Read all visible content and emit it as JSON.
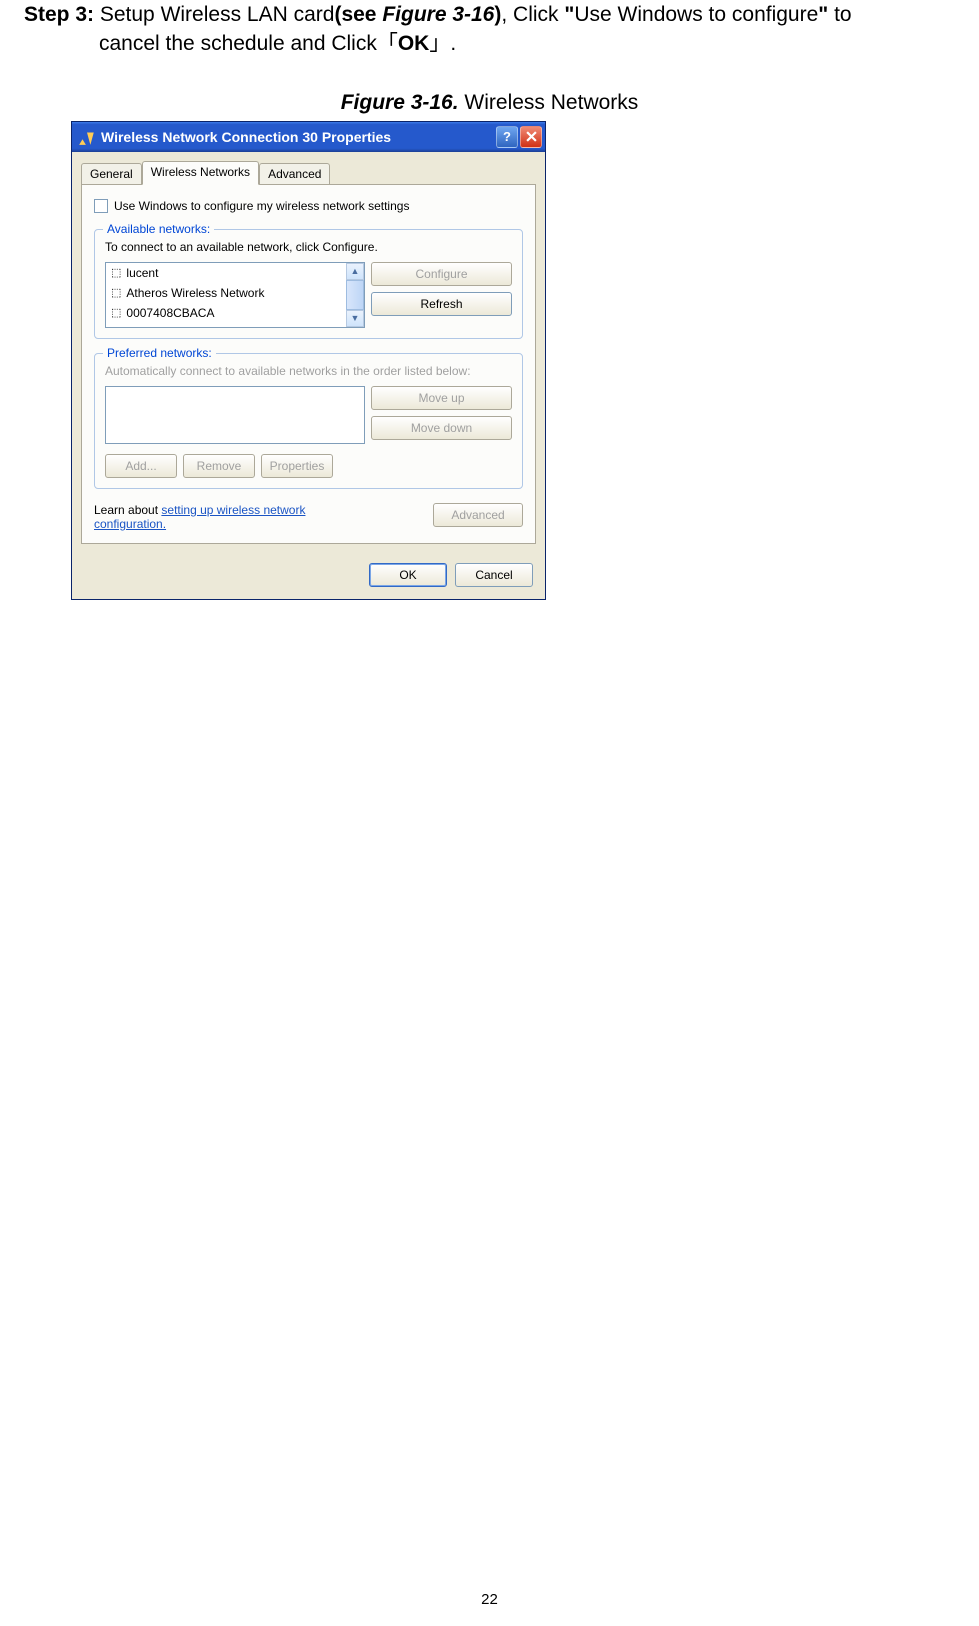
{
  "step": {
    "label": "Step 3: ",
    "text_before": "Setup Wireless LAN card",
    "see_open": "(see ",
    "see_ref": "Figure 3-16",
    "see_close": ")",
    "text_mid": ", Click ",
    "quote_open": "\"",
    "text_use": "Use Windows to configure",
    "quote_close": "\"",
    "text_to": " to",
    "line2_before": "cancel the schedule and Click「",
    "ok": "OK",
    "line2_after": "」."
  },
  "figure": {
    "label": "Figure 3-16.",
    "gap": "    ",
    "title": "Wireless Networks"
  },
  "dialog": {
    "title": "Wireless Network Connection 30 Properties",
    "help": "?",
    "tabs": {
      "general": "General",
      "wireless": "Wireless Networks",
      "advanced": "Advanced"
    },
    "checkbox_label": "Use Windows to configure my wireless network settings",
    "available": {
      "title": "Available networks:",
      "desc": "To connect to an available network, click Configure.",
      "items": [
        "lucent",
        "Atheros Wireless Network",
        "0007408CBACA"
      ],
      "configure": "Configure",
      "refresh": "Refresh"
    },
    "preferred": {
      "title": "Preferred networks:",
      "desc": "Automatically connect to available networks in the order listed below:",
      "moveup": "Move up",
      "movedown": "Move down",
      "add": "Add...",
      "remove": "Remove",
      "properties": "Properties"
    },
    "learn": {
      "before": "Learn about ",
      "link": "setting up wireless network configuration.",
      "advanced": "Advanced"
    },
    "bottom": {
      "ok": "OK",
      "cancel": "Cancel"
    }
  },
  "page_number": "22"
}
